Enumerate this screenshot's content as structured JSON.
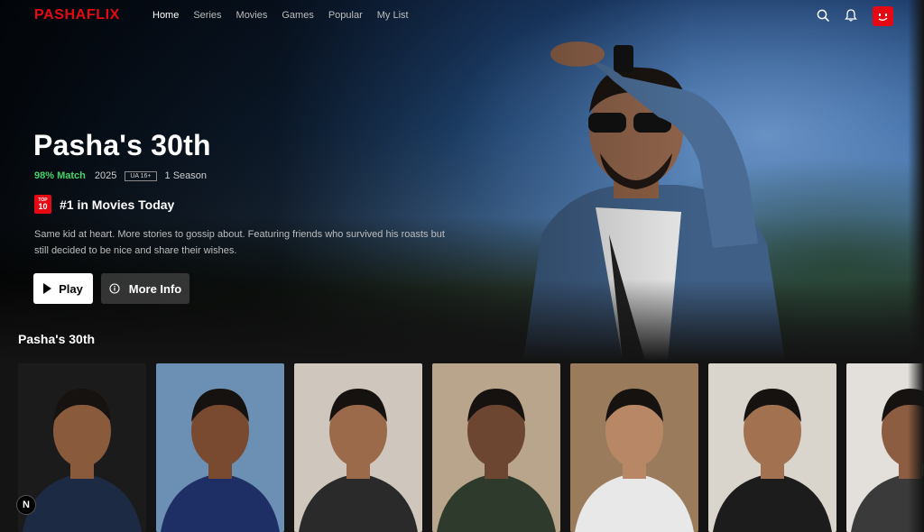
{
  "app": {
    "logo": "PASHAFLIX",
    "brand_color": "#e50914"
  },
  "nav": {
    "links": [
      {
        "label": "Home",
        "active": true
      },
      {
        "label": "Series"
      },
      {
        "label": "Movies"
      },
      {
        "label": "Games"
      },
      {
        "label": "Popular"
      },
      {
        "label": "My List"
      }
    ],
    "icons": [
      "search-icon",
      "bell-icon",
      "profile-avatar"
    ]
  },
  "hero": {
    "title": "Pasha's 30th",
    "match": "98% Match",
    "year": "2025",
    "rating": "UA 16+",
    "seasons": "1 Season",
    "top10_badge": {
      "line1": "TOP",
      "line2": "10"
    },
    "rank_text": "#1 in Movies Today",
    "description": "Same kid at heart. More stories to gossip about. Featuring friends who survived his roasts but still decided to be nice and share their wishes.",
    "play_label": "Play",
    "info_label": "More Info"
  },
  "row": {
    "title": "Pasha's 30th",
    "thumbnails": [
      {
        "name": "thumb-1",
        "bg": "#1b1b1b",
        "skin": "#8a5a3c",
        "shirt": "#1d2a44"
      },
      {
        "name": "thumb-2",
        "bg": "#6c8fb4",
        "skin": "#7a4a30",
        "shirt": "#1e2f66"
      },
      {
        "name": "thumb-3",
        "bg": "#cfc7bd",
        "skin": "#9a6a4a",
        "shirt": "#2a2a2a"
      },
      {
        "name": "thumb-4",
        "bg": "#b8a58c",
        "skin": "#6d4632",
        "shirt": "#2e3b2c"
      },
      {
        "name": "thumb-5",
        "bg": "#9a7b5c",
        "skin": "#b88866",
        "shirt": "#e8e8e8"
      },
      {
        "name": "thumb-6",
        "bg": "#d9d4cc",
        "skin": "#a2714f",
        "shirt": "#1c1c1c"
      },
      {
        "name": "thumb-7",
        "bg": "#e3e0db",
        "skin": "#8c5d40",
        "shirt": "#3a3a3a"
      }
    ]
  },
  "badge": {
    "letter": "N"
  }
}
